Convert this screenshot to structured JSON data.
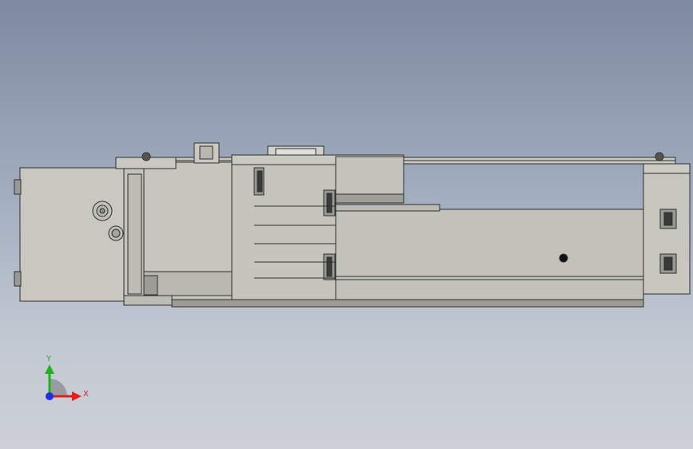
{
  "triad": {
    "x_label": "X",
    "y_label": "Y",
    "x_color": "#e02020",
    "y_color": "#20b020",
    "z_color": "#2030e0"
  },
  "colors": {
    "part_fill": "#c4c4bd",
    "part_fill_light": "#cfcfc8",
    "part_fill_dark": "#a9a9a2",
    "edge": "#2e2e2e",
    "shadow": "#8c8c86"
  }
}
